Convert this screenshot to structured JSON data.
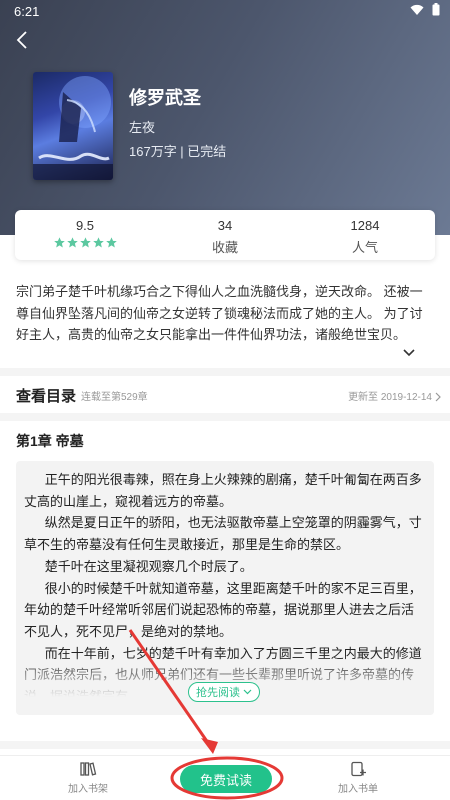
{
  "status_bar": {
    "time": "6:21"
  },
  "book": {
    "title": "修罗武圣",
    "author": "左夜",
    "meta": "167万字 | 已完结"
  },
  "stats": {
    "rating": {
      "value": "9.5",
      "stars": 5
    },
    "favorites": {
      "value": "34",
      "label": "收藏"
    },
    "popularity": {
      "value": "1284",
      "label": "人气"
    }
  },
  "synopsis": "宗门弟子楚千叶机缘巧合之下得仙人之血洗髓伐身，逆天改命。 还被一尊自仙界坠落凡间的仙帝之女逆转了锁魂秘法而成了她的主人。 为了讨好主人，高贵的仙帝之女只能拿出一件件仙界功法，诸般绝世宝贝。",
  "catalog": {
    "title": "查看目录",
    "status": "连载至第529章",
    "update": "更新至 2019-12-14"
  },
  "chapter": {
    "title": "第1章 帝墓",
    "paragraphs": [
      "正午的阳光很毒辣，照在身上火辣辣的剧痛，楚千叶匍匐在两百多丈高的山崖上，窥视着远方的帝墓。",
      "纵然是夏日正午的骄阳，也无法驱散帝墓上空笼罩的阴霾雾气，寸草不生的帝墓没有任何生灵敢接近，那里是生命的禁区。",
      "楚千叶在这里凝视观察几个时辰了。",
      "很小的时候楚千叶就知道帝墓，这里距离楚千叶的家不足三百里，年幼的楚千叶经常听邻居们说起恐怖的帝墓，据说那里人进去之后活不见人，死不见尸，是绝对的禁地。",
      "而在十年前，七岁的楚千叶有幸加入了方圆三千里之内最大的修道门派浩然宗后，也从师兄弟们还有一些长辈那里听说了许多帝墓的传说，据说浩然宗有"
    ],
    "read_more": "抢先阅读"
  },
  "bottom_bar": {
    "add_shelf": "加入书架",
    "free_read": "免费试读",
    "add_list": "加入书单"
  },
  "colors": {
    "accent": "#22c28b",
    "annotation": "#e53935"
  }
}
